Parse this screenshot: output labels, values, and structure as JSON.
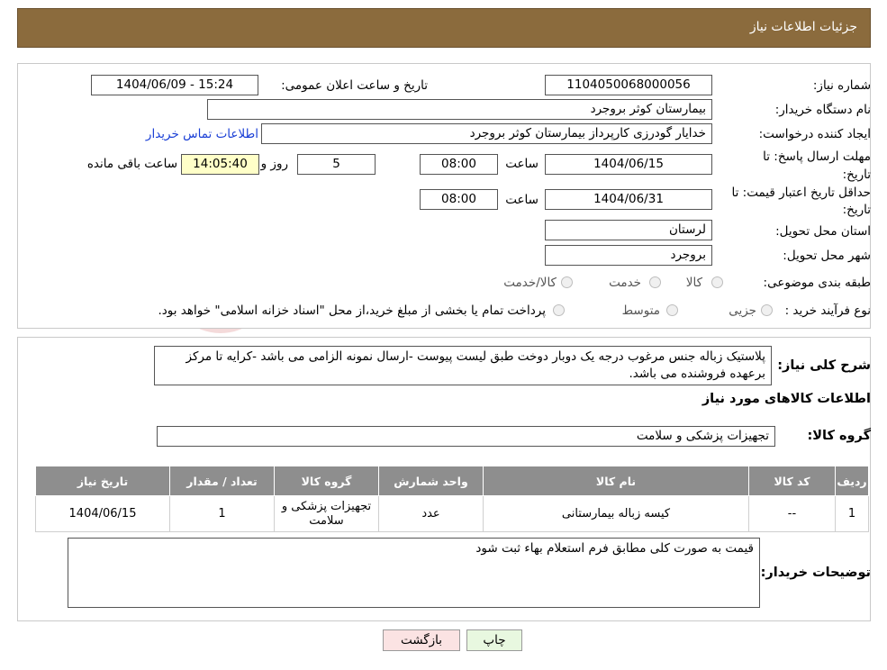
{
  "header": {
    "title": "جزئیات اطلاعات نیاز"
  },
  "info": {
    "need_number_label": "شماره نیاز:",
    "need_number": "1104050068000056",
    "announce_label": "تاریخ و ساعت اعلان عمومی:",
    "announce_value": "1404/06/09 - 15:24",
    "buyer_org_label": "نام دستگاه خریدار:",
    "buyer_org": "بیمارستان کوثر بروجرد",
    "creator_label": "ایجاد کننده درخواست:",
    "creator": "خدایار  گودرزی کارپرداز بیمارستان کوثر بروجرد",
    "contact_link": "اطلاعات تماس خریدار",
    "deadline_label_1": "مهلت ارسال پاسخ: تا",
    "deadline_label_2": "تاریخ:",
    "deadline_date": "1404/06/15",
    "time_label": "ساعت",
    "deadline_time": "08:00",
    "days_value": "5",
    "days_label": "روز و",
    "remaining_time": "14:05:40",
    "remaining_label": "ساعت باقی مانده",
    "validity_label_1": "حداقل تاریخ اعتبار قیمت: تا",
    "validity_label_2": "تاریخ:",
    "validity_date": "1404/06/31",
    "validity_time": "08:00",
    "province_label": "استان محل تحویل:",
    "province": "لرستان",
    "city_label": "شهر محل تحویل:",
    "city": "بروجرد",
    "category_label": "طبقه بندی موضوعی:",
    "category_options": [
      "کالا",
      "خدمت",
      "کالا/خدمت"
    ],
    "process_label": "نوع فرآیند خرید :",
    "process_options": [
      "جزیی",
      "متوسط"
    ],
    "process_note": "پرداخت تمام یا بخشی از مبلغ خرید،از محل \"اسناد خزانه اسلامی\" خواهد بود."
  },
  "description": {
    "label": "شرح کلی نیاز:",
    "text": "پلاستیک زباله جنس مرغوب درجه یک دوبار دوخت طبق لیست پیوست -ارسال نمونه الزامی می باشد -کرایه تا مرکز برعهده فروشنده می باشد."
  },
  "goods": {
    "section_title": "اطلاعات کالاهای مورد نیاز",
    "group_label": "گروه کالا:",
    "group_value": "تجهیزات پزشکی و سلامت",
    "columns": [
      "ردیف",
      "کد کالا",
      "نام کالا",
      "واحد شمارش",
      "گروه کالا",
      "تعداد / مقدار",
      "تاریخ نیاز"
    ],
    "rows": [
      [
        "1",
        "--",
        "کیسه زباله بیمارستانی",
        "عدد",
        "تجهیزات پزشکی و سلامت",
        "1",
        "1404/06/15"
      ]
    ]
  },
  "buyer_notes": {
    "label": "توضیحات خریدار:",
    "text": "قیمت به صورت کلی مطابق فرم استعلام بهاء ثبت شود"
  },
  "buttons": {
    "print": "چاپ",
    "back": "بازگشت"
  },
  "watermark": {
    "text": "AriaTender.neT"
  },
  "colors": {
    "header_bg": "#8b6b3d",
    "table_header_bg": "#8e8e8e",
    "link": "#1a3fd6",
    "remaining_bg": "#ffffc8",
    "print_bg": "#e8f8e0",
    "back_bg": "#fbe3e3"
  }
}
